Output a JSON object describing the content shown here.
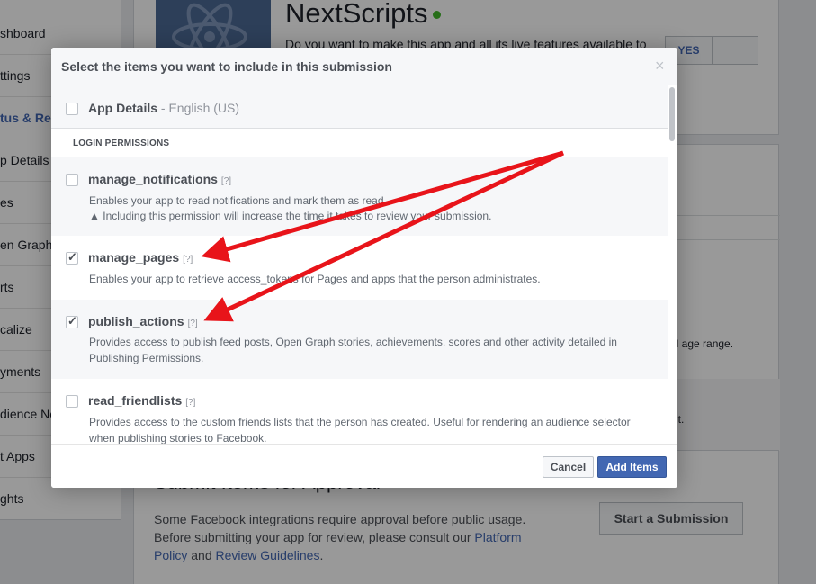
{
  "sidebar": {
    "items": [
      {
        "label": "shboard"
      },
      {
        "label": "ttings"
      },
      {
        "label": "tus & Re"
      },
      {
        "label": "p Details"
      },
      {
        "label": "es"
      },
      {
        "label": "en Graph"
      },
      {
        "label": "rts"
      },
      {
        "label": "calize"
      },
      {
        "label": "yments"
      },
      {
        "label": "dience Ne"
      },
      {
        "label": "t Apps"
      },
      {
        "label": "ghts"
      }
    ]
  },
  "app": {
    "name": "NextScripts",
    "live_question": "Do you want to make this app and all its live features available to",
    "toggle_yes": "YES"
  },
  "background": {
    "age_text": "nd age range.",
    "lt_text": "lt."
  },
  "submit": {
    "title": "Submit Items for Approval",
    "desc_part1": "Some Facebook integrations require approval before public usage. Before submitting your app for review, please consult our ",
    "link1": "Platform Policy",
    "desc_part2": " and ",
    "link2": "Review Guidelines",
    "desc_part3": ".",
    "start_button": "Start a Submission"
  },
  "modal": {
    "title": "Select the items you want to include in this submission",
    "close": "×",
    "app_details": {
      "label": "App Details",
      "language": " - English (US)",
      "checked": false
    },
    "section_label": "LOGIN PERMISSIONS",
    "help": "[?]",
    "permissions": [
      {
        "name": "manage_notifications",
        "checked": false,
        "desc": "Enables your app to read notifications and mark them as read.",
        "warning": "Including this permission will increase the time it takes to review your submission."
      },
      {
        "name": "manage_pages",
        "checked": true,
        "desc": "Enables your app to retrieve access_tokens for Pages and apps that the person administrates."
      },
      {
        "name": "publish_actions",
        "checked": true,
        "desc": "Provides access to publish feed posts, Open Graph stories, achievements, scores and other activity detailed in Publishing Permissions."
      },
      {
        "name": "read_friendlists",
        "checked": false,
        "desc": "Provides access to the custom friends lists that the person has created. Useful for rendering an audience selector when publishing stories to Facebook."
      }
    ],
    "cancel_label": "Cancel",
    "add_label": "Add Items"
  },
  "colors": {
    "annotation_arrow": "#e8141a",
    "primary_button": "#4267b2",
    "live_dot": "#42b72a"
  }
}
